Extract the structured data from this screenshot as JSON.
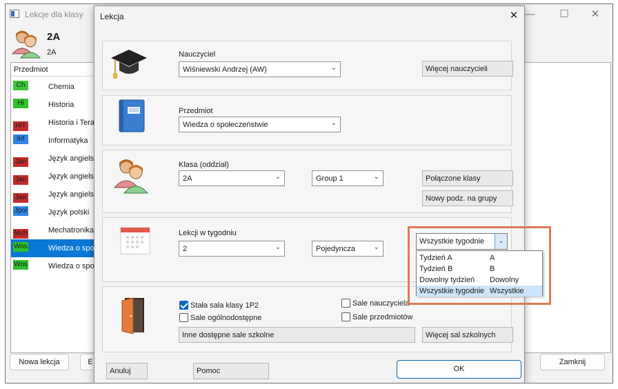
{
  "bg_window": {
    "title": "Lekcje dla klasy",
    "class_name": "2A",
    "class_sub": "2A",
    "list_header": "Przedmiot",
    "subjects": [
      {
        "tag": "Ch",
        "name": "Chemia",
        "color": "#39c939"
      },
      {
        "tag": "Hi",
        "name": "Historia",
        "color": "#2fc12f"
      },
      {
        "tag": "HiT",
        "name": "Historia i Tera",
        "color": "#c22b2b"
      },
      {
        "tag": "Inf",
        "name": "Informatyka",
        "color": "#2f86e5"
      },
      {
        "tag": "Jan",
        "name": "Język angiels",
        "color": "#c22b2b"
      },
      {
        "tag": "Jan",
        "name": "Język angiels",
        "color": "#c22b2b"
      },
      {
        "tag": "Jan",
        "name": "Język angiels",
        "color": "#c22b2b"
      },
      {
        "tag": "Jpol",
        "name": "Język polski",
        "color": "#2f86e5"
      },
      {
        "tag": "Mch",
        "name": "Mechatronika",
        "color": "#c22b2b"
      },
      {
        "tag": "Wos",
        "name": "Wiedza o spo",
        "color": "#2fc12f"
      },
      {
        "tag": "Wos",
        "name": "Wiedza o spo",
        "color": "#2fc12f"
      }
    ],
    "new_lesson_label": "Nowa lekcja",
    "e_label": "E",
    "close_label": "Zamknij",
    "window_controls": {
      "minimize": "—",
      "maximize": "☐",
      "close": "✕"
    }
  },
  "dialog": {
    "title": "Lekcja",
    "close_glyph": "✕",
    "teacher": {
      "label": "Nauczyciel",
      "value": "Wiśniewski Andrzej (AW)",
      "more_label": "Więcej nauczycieli"
    },
    "subject": {
      "label": "Przedmiot",
      "value": "Wiedza o społeczeństwie"
    },
    "class": {
      "label": "Klasa (oddział)",
      "value": "2A",
      "group": "Group 1",
      "joined_label": "Połączone klasy",
      "new_split_label": "Nowy podz. na grupy"
    },
    "lessons": {
      "label": "Lekcji w tygodniu",
      "count": "2",
      "kind": "Pojedyncza",
      "week_value": "Wszystkie tygodnie",
      "week_options": [
        {
          "name": "Tydzień A",
          "short": "A"
        },
        {
          "name": "Tydzień B",
          "short": "B"
        },
        {
          "name": "Dowolny tydzień",
          "short": "Dowolny"
        },
        {
          "name": "Wszystkie tygodnie",
          "short": "Wszystkie"
        }
      ]
    },
    "rooms": {
      "fixed_room_label": "Stała sala klasy 1P2",
      "fixed_room_checked": true,
      "general_label": "Sale ogólnodostępne",
      "teacher_rooms_label": "Sale nauczyciela",
      "subject_rooms_label": "Sale przedmiotów",
      "other_label": "Inne dostępne sale szkolne",
      "more_label": "Więcej sal szkolnych"
    },
    "cancel_label": "Anuluj",
    "help_label": "Pomoc",
    "ok_label": "OK"
  }
}
